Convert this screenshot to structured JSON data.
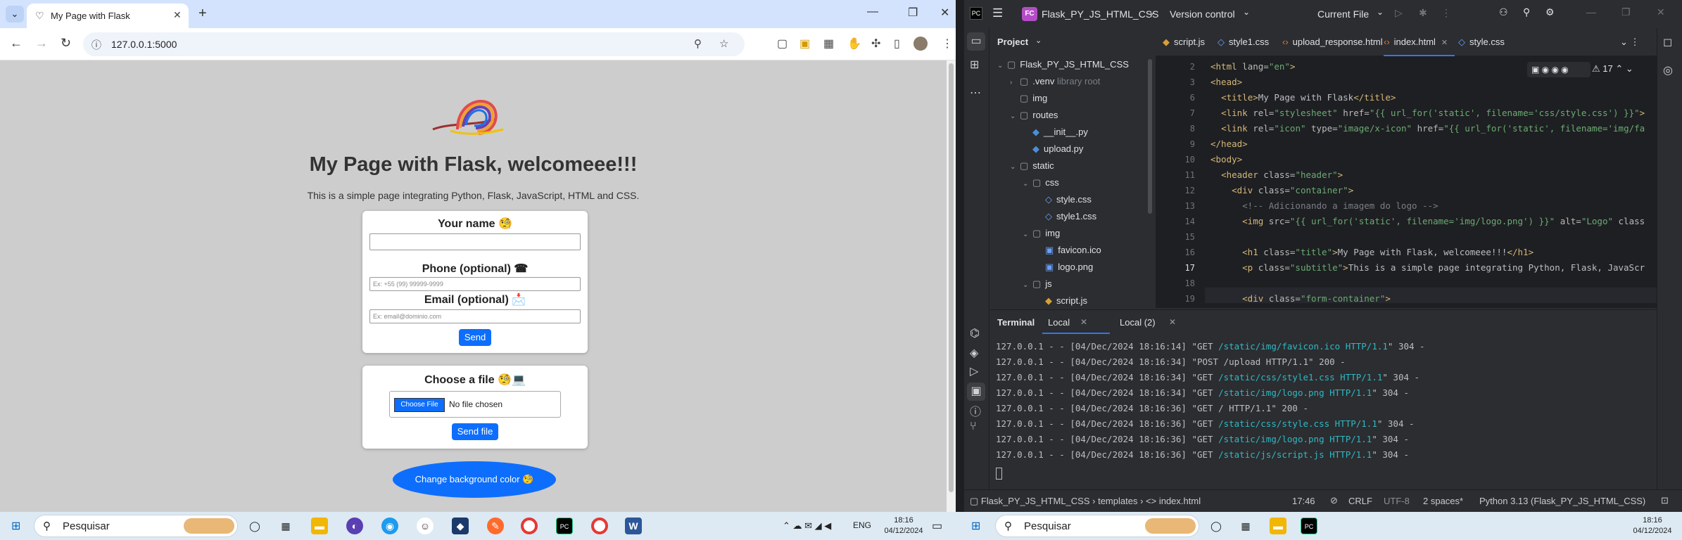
{
  "browser": {
    "tab_title": "My Page with Flask",
    "address": "127.0.0.1:5000",
    "page": {
      "title": "My Page with Flask, welcomeee!!!",
      "subtitle": "This is a simple page integrating Python, Flask, JavaScript, HTML and CSS.",
      "form": {
        "name_label": "Your name 🧐",
        "phone_label": "Phone (optional) ☎",
        "phone_placeholder": "Ex: +55 (99) 99999-9999",
        "email_label": "Email (optional) 📩",
        "email_placeholder": "Ex: email@dominio.com",
        "send_label": "Send"
      },
      "upload": {
        "title": "Choose a file 🧐💻",
        "choose_label": "Choose File",
        "no_file": "No file chosen",
        "send_label": "Send file"
      },
      "bg_button": "Change background color 🧐"
    }
  },
  "ide": {
    "project_initials": "FC",
    "project_name": "Flask_PY_JS_HTML_CSS",
    "vcs": "Version control",
    "run_config": "Current File",
    "panel_title": "Project",
    "tree": [
      {
        "name": "Flask_PY_JS_HTML_CSS",
        "indent": 0,
        "arrow": "⌄",
        "icon": "folder"
      },
      {
        "name": ".venv",
        "extra": "library root",
        "indent": 1,
        "arrow": "›",
        "icon": "folder"
      },
      {
        "name": "img",
        "indent": 1,
        "arrow": "",
        "icon": "folder"
      },
      {
        "name": "routes",
        "indent": 1,
        "arrow": "⌄",
        "icon": "folder"
      },
      {
        "name": "__init__.py",
        "indent": 2,
        "arrow": "",
        "icon": "py"
      },
      {
        "name": "upload.py",
        "indent": 2,
        "arrow": "",
        "icon": "py"
      },
      {
        "name": "static",
        "indent": 1,
        "arrow": "⌄",
        "icon": "folder"
      },
      {
        "name": "css",
        "indent": 2,
        "arrow": "⌄",
        "icon": "folder"
      },
      {
        "name": "style.css",
        "indent": 3,
        "arrow": "",
        "icon": "css"
      },
      {
        "name": "style1.css",
        "indent": 3,
        "arrow": "",
        "icon": "css"
      },
      {
        "name": "img",
        "indent": 2,
        "arrow": "⌄",
        "icon": "folder"
      },
      {
        "name": "favicon.ico",
        "indent": 3,
        "arrow": "",
        "icon": "img"
      },
      {
        "name": "logo.png",
        "indent": 3,
        "arrow": "",
        "icon": "img"
      },
      {
        "name": "js",
        "indent": 2,
        "arrow": "⌄",
        "icon": "folder"
      },
      {
        "name": "script.js",
        "indent": 3,
        "arrow": "",
        "icon": "js"
      }
    ],
    "editor_tabs": [
      "script.js",
      "style1.css",
      "upload_response.html",
      "index.html",
      "style.css"
    ],
    "active_tab": "index.html",
    "warnings_count": "17",
    "code_lines": [
      {
        "n": "2",
        "html": "<span class=\"tg\">&lt;html</span> <span class=\"at\">lang=</span><span class=\"st\">\"en\"</span><span class=\"tg\">&gt;</span>"
      },
      {
        "n": "3",
        "html": "<span class=\"tg\">&lt;head&gt;</span>"
      },
      {
        "n": "6",
        "html": "  <span class=\"tg\">&lt;title&gt;</span>My Page with Flask<span class=\"tg\">&lt;/title&gt;</span>"
      },
      {
        "n": "7",
        "html": "  <span class=\"tg\">&lt;link</span> <span class=\"at\">rel=</span><span class=\"st\">\"stylesheet\"</span> <span class=\"at\">href=</span><span class=\"st\">\"{{ url_for('static', filename='css/style.css') }}\"</span><span class=\"tg\">&gt;</span>"
      },
      {
        "n": "8",
        "html": "  <span class=\"tg\">&lt;link</span> <span class=\"at\">rel=</span><span class=\"st\">\"icon\"</span> <span class=\"at\">type=</span><span class=\"st\">\"image/x-icon\"</span> <span class=\"at\">href=</span><span class=\"st\">\"{{ url_for('static', filename='img/fa</span>"
      },
      {
        "n": "9",
        "html": "<span class=\"tg\">&lt;/head&gt;</span>"
      },
      {
        "n": "10",
        "html": "<span class=\"tg\">&lt;body&gt;</span>"
      },
      {
        "n": "11",
        "html": "  <span class=\"tg\">&lt;header</span> <span class=\"at\">class=</span><span class=\"st\">\"header\"</span><span class=\"tg\">&gt;</span>"
      },
      {
        "n": "12",
        "html": "    <span class=\"tg\">&lt;div</span> <span class=\"at\">class=</span><span class=\"st\">\"container\"</span><span class=\"tg\">&gt;</span>"
      },
      {
        "n": "13",
        "html": "      <span class=\"cm\">&lt;!-- Adicionando a imagem do logo --&gt;</span>"
      },
      {
        "n": "14",
        "html": "      <span class=\"tg\">&lt;img</span> <span class=\"at\">src=</span><span class=\"st\">\"{{ url_for('static', filename='img/logo.png') }}\"</span> <span class=\"at\">alt=</span><span class=\"st\">\"Logo\"</span> <span class=\"at\">class</span>"
      },
      {
        "n": "15",
        "html": ""
      },
      {
        "n": "16",
        "html": "      <span class=\"tg\">&lt;h1</span> <span class=\"at\">class=</span><span class=\"st\">\"title\"</span><span class=\"tg\">&gt;</span>My Page with Flask, welcomeee!!!<span class=\"tg\">&lt;/h1&gt;</span>"
      },
      {
        "n": "17",
        "html": "      <span class=\"tg\">&lt;p</span> <span class=\"at\">class=</span><span class=\"st\">\"subtitle\"</span><span class=\"tg\">&gt;</span>This is a simple page integrating Python, Flask, JavaScr"
      },
      {
        "n": "18",
        "html": ""
      },
      {
        "n": "19",
        "html": "      <span class=\"tg\">&lt;div</span> <span class=\"at\">class=</span><span class=\"st\">\"form-container\"</span><span class=\"tg\">&gt;</span>"
      }
    ],
    "terminal": {
      "title": "Terminal",
      "tabs": [
        "Local",
        "Local (2)"
      ],
      "lines": [
        {
          "pre": "127.0.0.1 - - [04/Dec/2024 18:16:14] \"GET ",
          "url": "/static/img/favicon.ico HTTP/1.1",
          "post": "\" 304 -"
        },
        {
          "pre": "127.0.0.1 - - [04/Dec/2024 18:16:34] \"POST /upload HTTP/1.1\" 200 -",
          "url": "",
          "post": ""
        },
        {
          "pre": "127.0.0.1 - - [04/Dec/2024 18:16:34] \"GET ",
          "url": "/static/css/style1.css HTTP/1.1",
          "post": "\" 304 -"
        },
        {
          "pre": "127.0.0.1 - - [04/Dec/2024 18:16:34] \"GET ",
          "url": "/static/img/logo.png HTTP/1.1",
          "post": "\" 304 -"
        },
        {
          "pre": "127.0.0.1 - - [04/Dec/2024 18:16:36] \"GET / HTTP/1.1\" 200 -",
          "url": "",
          "post": ""
        },
        {
          "pre": "127.0.0.1 - - [04/Dec/2024 18:16:36] \"GET ",
          "url": "/static/css/style.css HTTP/1.1",
          "post": "\" 304 -"
        },
        {
          "pre": "127.0.0.1 - - [04/Dec/2024 18:16:36] \"GET ",
          "url": "/static/img/logo.png HTTP/1.1",
          "post": "\" 304 -"
        },
        {
          "pre": "127.0.0.1 - - [04/Dec/2024 18:16:36] \"GET ",
          "url": "/static/js/script.js HTTP/1.1",
          "post": "\" 304 -"
        }
      ]
    },
    "status": {
      "crumbs": [
        "Flask_PY_JS_HTML_CSS",
        "templates",
        "index.html"
      ],
      "position": "17:46",
      "line_sep": "CRLF",
      "encoding": "UTF-8",
      "indent": "2 spaces*",
      "interpreter": "Python 3.13 (Flask_PY_JS_HTML_CSS)"
    }
  },
  "taskbar": {
    "search_label": "Pesquisar",
    "lang": "ENG",
    "time": "18:16",
    "date": "04/12/2024"
  }
}
